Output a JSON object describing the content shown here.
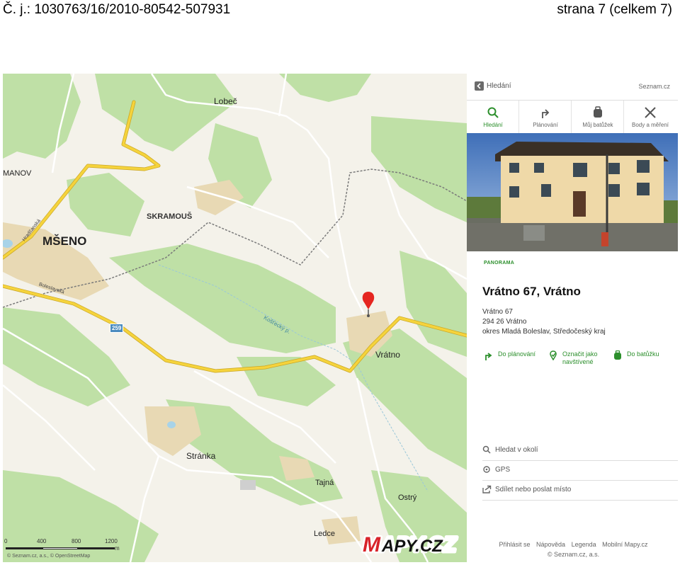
{
  "document": {
    "reference": "Č. j.: 1030763/16/2010-80542-507931",
    "page": "strana 7 (celkem 7)"
  },
  "map": {
    "labels": {
      "lobec": "Lobeč",
      "manov": "MANOV",
      "skramous": "SKRAMOUŠ",
      "mseno": "MŠENO",
      "vratno": "Vrátno",
      "stranka": "Stránka",
      "tajna": "Tajná",
      "ostry": "Ostrý",
      "ledce": "Ledce",
      "boleslavska": "Boleslavská",
      "hradcanska": "Hradčanská",
      "kostecky": "Košťecký p.",
      "road_number": "259"
    },
    "scale": {
      "ticks": [
        "0",
        "400",
        "800",
        "1200"
      ],
      "unit": "m"
    },
    "attribution": "© Seznam.cz, a.s., © OpenStreetMap",
    "logo": "MAPY.CZ",
    "icons": {
      "marker": "map-pin-icon"
    },
    "colors": {
      "highway": "#f5d33c",
      "forest": "#bfe0a6",
      "settlement": "#e8d9b4",
      "marker": "#e52620"
    }
  },
  "panel": {
    "back_label": "Hledání",
    "brand": "Seznam.cz",
    "tabs": [
      {
        "label": "Hledání",
        "icon": "search-icon"
      },
      {
        "label": "Plánování",
        "icon": "route-icon"
      },
      {
        "label": "Můj batůžek",
        "icon": "backpack-icon"
      },
      {
        "label": "Body a měření",
        "icon": "measure-icon"
      }
    ],
    "section_tag": "PANORAMA",
    "poi_title": "Vrátno 67, Vrátno",
    "address": [
      "Vrátno 67",
      "294 26 Vrátno",
      "okres Mladá Boleslav, Středočeský kraj"
    ],
    "actions": [
      "Do plánování",
      "Označit jako navštívené",
      "Do batůžku"
    ],
    "tools": [
      "Hledat v okolí",
      "GPS",
      "Sdílet nebo poslat místo"
    ],
    "footer_links": [
      "Přihlásit se",
      "Nápověda",
      "Legenda",
      "Mobilní Mapy.cz"
    ],
    "footer_copy": "© Seznam.cz, a.s.",
    "accent": "#2c8f2c"
  }
}
